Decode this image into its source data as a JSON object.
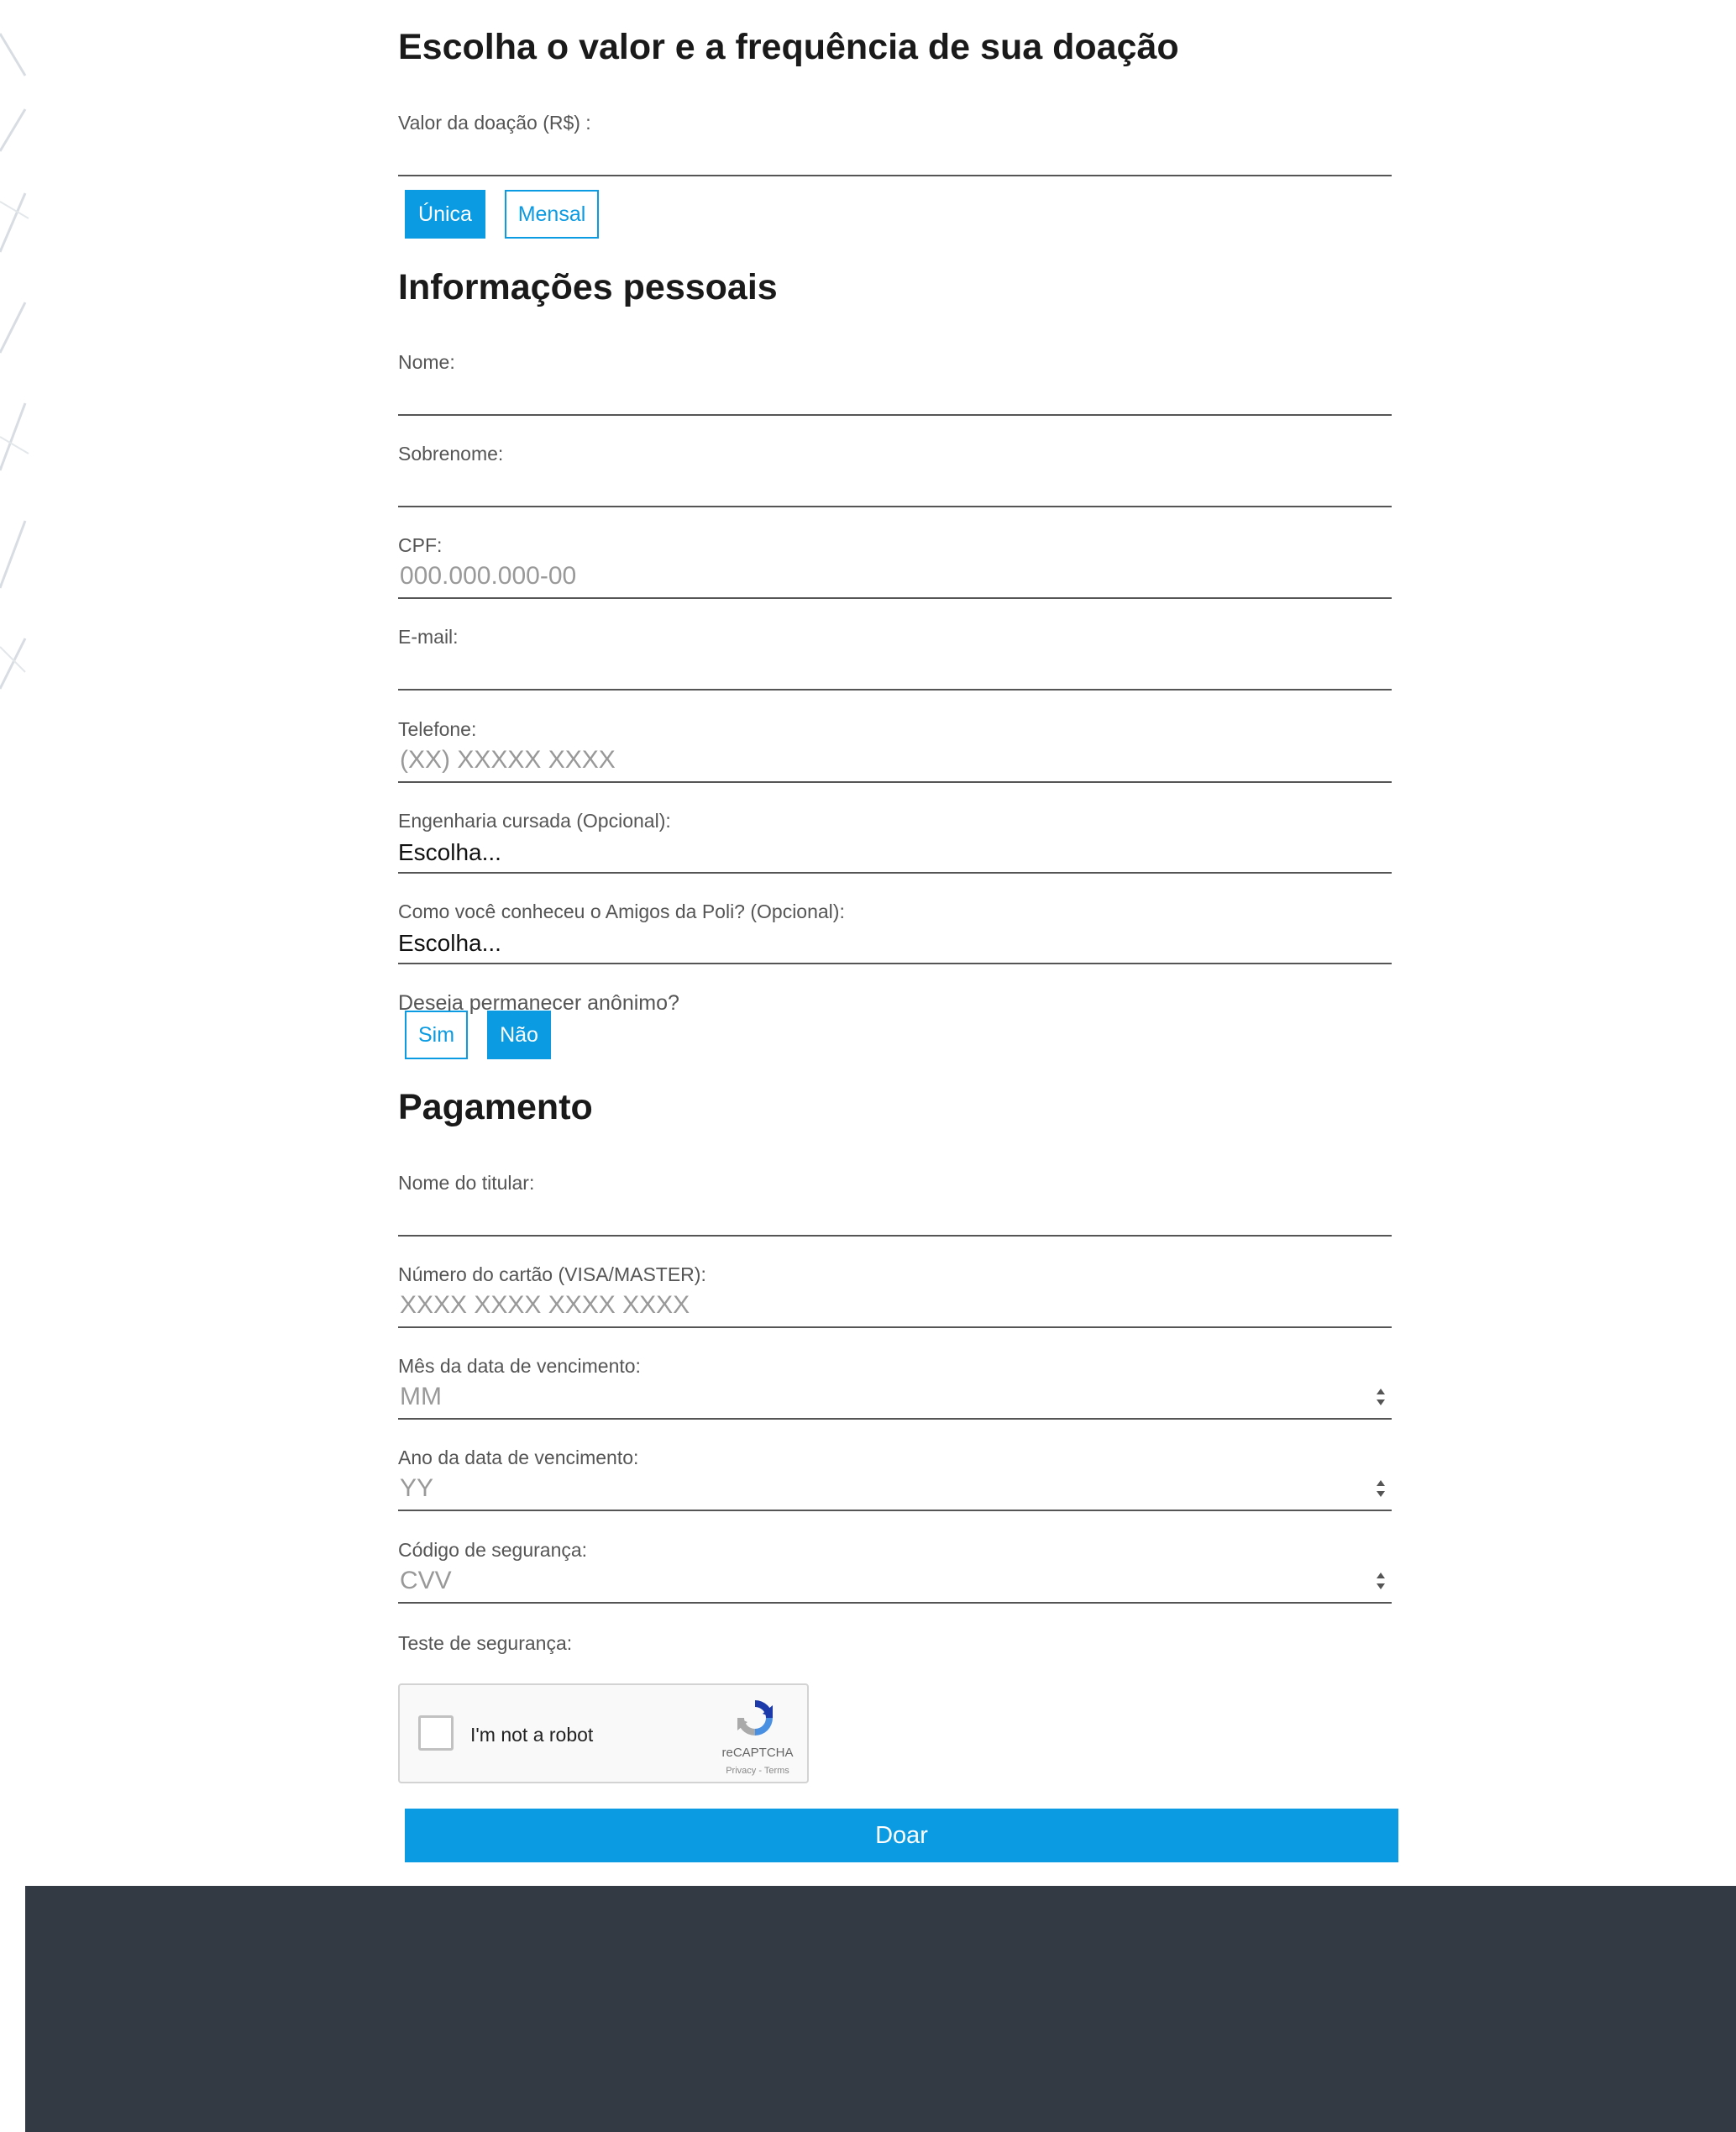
{
  "sections": {
    "donation_title": "Escolha o valor e a frequência de sua doação",
    "personal_title": "Informações pessoais",
    "payment_title": "Pagamento"
  },
  "donation": {
    "amount_label": "Valor da doação (R$) :",
    "frequency": {
      "once": "Única",
      "monthly": "Mensal",
      "selected": "once"
    }
  },
  "personal": {
    "name_label": "Nome:",
    "surname_label": "Sobrenome:",
    "cpf_label": "CPF:",
    "cpf_placeholder": "000.000.000-00",
    "email_label": "E-mail:",
    "phone_label": "Telefone:",
    "phone_placeholder": "(XX) XXXXX XXXX",
    "engineering_label": "Engenharia cursada (Opcional):",
    "engineering_value": "Escolha...",
    "source_label": "Como você conheceu o Amigos da Poli? (Opcional):",
    "source_value": "Escolha...",
    "anonymous_label": "Deseja permanecer anônimo?",
    "anonymous": {
      "yes": "Sim",
      "no": "Não",
      "selected": "no"
    }
  },
  "payment": {
    "holder_label": "Nome do titular:",
    "card_label": "Número do cartão (VISA/MASTER):",
    "card_placeholder": "XXXX XXXX XXXX XXXX",
    "month_label": "Mês da data de vencimento:",
    "month_placeholder": "MM",
    "year_label": "Ano da data de vencimento:",
    "year_placeholder": "YY",
    "cvv_label": "Código de segurança:",
    "cvv_placeholder": "CVV",
    "security_test_label": "Teste de segurança:"
  },
  "captcha": {
    "text": "I'm not a robot",
    "brand": "reCAPTCHA",
    "links": "Privacy - Terms"
  },
  "submit_label": "Doar",
  "colors": {
    "accent": "#0a9be3",
    "footer": "#343a43"
  }
}
